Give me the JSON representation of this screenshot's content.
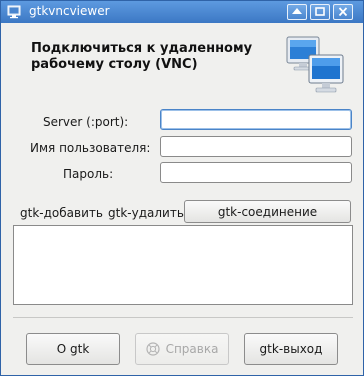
{
  "window": {
    "title": "gtkvncviewer"
  },
  "heading": "Подключиться к удаленному рабочему столу (VNC)",
  "form": {
    "server_label": "Server (:port):",
    "server_value": "",
    "user_label": "Имя пользователя:",
    "user_value": "",
    "password_label": "Пароль:",
    "password_value": ""
  },
  "actions": {
    "add_label": "gtk-добавить",
    "remove_label": "gtk-удалить",
    "connect_label": "gtk-соединение"
  },
  "footer": {
    "about_label": "О gtk",
    "help_label": "Справка",
    "quit_label": "gtk-выход"
  },
  "icons": {
    "app": "computer-icon",
    "monitors": "network-monitors-icon",
    "help": "help-icon"
  },
  "colors": {
    "titlebar": "#4a86cf",
    "window_bg": "#f0f0ee",
    "focus": "#4a84c8"
  }
}
